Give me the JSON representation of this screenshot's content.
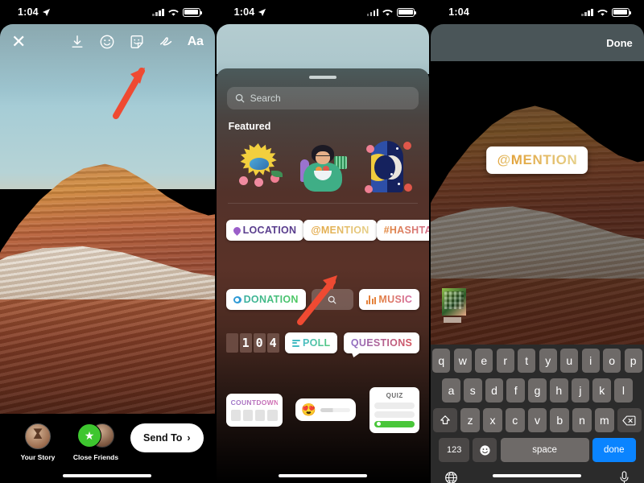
{
  "panels": [
    {
      "id": "story-editor",
      "status": {
        "time": "1:04",
        "location_arrow": true,
        "signal": "signal-bars-icon",
        "wifi": "wifi-icon",
        "battery": "battery-icon"
      },
      "toolbar": {
        "close_label": "✕",
        "icons": [
          "download-icon",
          "effects-smiley-icon",
          "sticker-icon",
          "draw-squiggle-icon"
        ],
        "text_tool_label": "Aa"
      },
      "arrow": {
        "name": "annotation-arrow",
        "color": "#ef4a32",
        "points_to": "sticker-icon"
      },
      "bottom": {
        "your_story_label": "Your Story",
        "close_friends_label": "Close Friends",
        "send_to_label": "Send To",
        "send_to_chevron": "›"
      }
    },
    {
      "id": "sticker-tray",
      "status": {
        "time": "1:04",
        "location_arrow": true
      },
      "search": {
        "placeholder": "Search",
        "icon": "search-icon"
      },
      "section_title": "Featured",
      "featured_stickers": [
        "sun-bird-flowers-sticker",
        "person-reading-sticker",
        "sun-moon-arch-sticker"
      ],
      "arrow": {
        "name": "annotation-arrow",
        "color": "#ef4a32",
        "points_to": "mention-sticker-button"
      },
      "chips_row1": [
        {
          "label": "LOCATION",
          "icon": "location-pin-icon",
          "style": "c-loc"
        },
        {
          "label": "@MENTION",
          "icon": "",
          "style": "grad-mention"
        },
        {
          "label": "#HASHTAG",
          "icon": "",
          "style": "grad-hash"
        }
      ],
      "chips_row2": [
        {
          "label": "DONATION",
          "icon": "donation-heart-icon",
          "style": "grad-don"
        },
        {
          "label": "",
          "icon": "search-icon",
          "style": "search"
        },
        {
          "label": "MUSIC",
          "icon": "music-equalizer-icon",
          "style": "grad-music"
        }
      ],
      "chips_row3": [
        {
          "label": "104",
          "icon": "counter-icon",
          "style": "counter"
        },
        {
          "label": "POLL",
          "icon": "poll-bars-icon",
          "style": "grad-poll"
        },
        {
          "label": "QUESTIONS",
          "icon": "",
          "style": "grad-quest"
        }
      ],
      "chips_row4": [
        {
          "label": "COUNTDOWN",
          "style": "countdown"
        },
        {
          "label": "",
          "emoji": "😍",
          "style": "emoji-slider"
        },
        {
          "label": "QUIZ",
          "style": "quiz"
        }
      ]
    },
    {
      "id": "mention-placed",
      "status": {
        "time": "1:04",
        "location_arrow": false
      },
      "done_label": "Done",
      "placed_sticker": {
        "at": "@",
        "text": "MENTION"
      },
      "keyboard": {
        "row1": [
          "q",
          "w",
          "e",
          "r",
          "t",
          "y",
          "u",
          "i",
          "o",
          "p"
        ],
        "row2": [
          "a",
          "s",
          "d",
          "f",
          "g",
          "h",
          "j",
          "k",
          "l"
        ],
        "row3": [
          "z",
          "x",
          "c",
          "v",
          "b",
          "n",
          "m"
        ],
        "shift_icon": "shift-arrow-icon",
        "backspace_icon": "backspace-icon",
        "numbers_label": "123",
        "emoji_icon": "emoji-face-icon",
        "space_label": "space",
        "return_label": "done",
        "globe_icon": "globe-icon",
        "mic_icon": "microphone-icon"
      }
    }
  ],
  "colors": {
    "accent_red": "#ef4a32",
    "ios_blue": "#0a84ff",
    "green": "#49c639"
  }
}
